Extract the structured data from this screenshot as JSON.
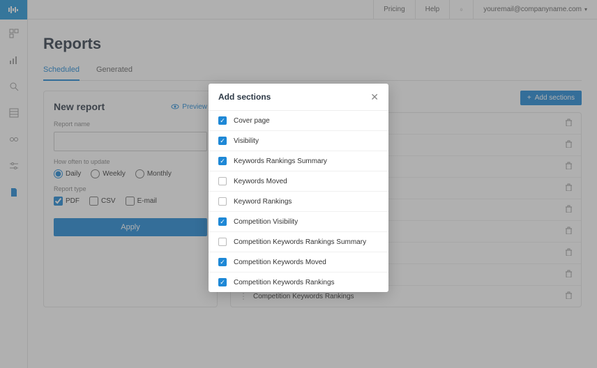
{
  "header": {
    "pricing": "Pricing",
    "help": "Help",
    "userEmail": "youremail@companyname.com"
  },
  "page": {
    "title": "Reports"
  },
  "tabs": {
    "scheduled": "Scheduled",
    "generated": "Generated"
  },
  "newReport": {
    "title": "New report",
    "preview": "Preview",
    "nameLabel": "Report name",
    "nameValue": "",
    "updateLabel": "How often to update",
    "freq": {
      "daily": "Daily",
      "weekly": "Weekly",
      "monthly": "Monthly"
    },
    "typeLabel": "Report type",
    "types": {
      "pdf": "PDF",
      "csv": "CSV",
      "email": "E-mail"
    },
    "apply": "Apply"
  },
  "addSectionsBtn": "Add sections",
  "sectionRows": [
    {
      "label": ""
    },
    {
      "label": ""
    },
    {
      "label": ""
    },
    {
      "label": ""
    },
    {
      "label": ""
    },
    {
      "label": ""
    },
    {
      "label": ""
    },
    {
      "label": ""
    },
    {
      "label": "Competition Keywords Rankings"
    }
  ],
  "modal": {
    "title": "Add sections",
    "options": [
      {
        "label": "Cover page",
        "checked": true
      },
      {
        "label": "Visibility",
        "checked": true
      },
      {
        "label": "Keywords Rankings Summary",
        "checked": true
      },
      {
        "label": "Keywords Moved",
        "checked": false
      },
      {
        "label": "Keyword Rankings",
        "checked": false
      },
      {
        "label": "Competition Visibility",
        "checked": true
      },
      {
        "label": "Competition Keywords Rankings Summary",
        "checked": false
      },
      {
        "label": "Competition Keywords Moved",
        "checked": true
      },
      {
        "label": "Competition Keywords Rankings",
        "checked": true
      }
    ]
  }
}
